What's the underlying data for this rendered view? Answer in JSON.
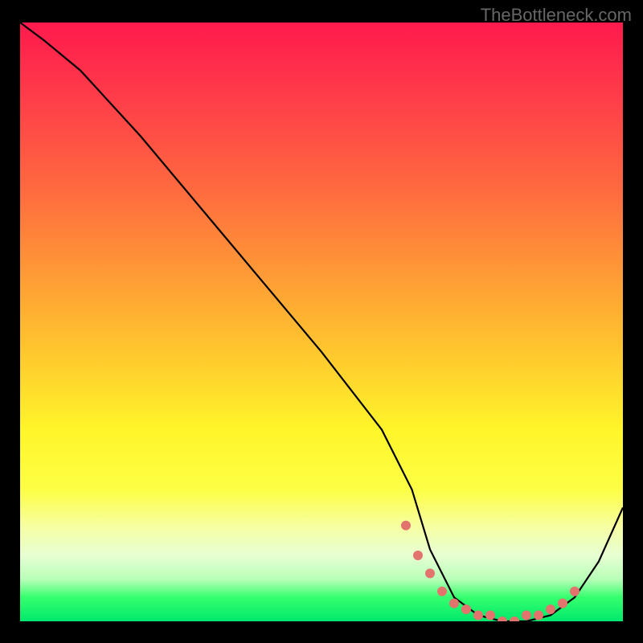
{
  "watermark": "TheBottleneck.com",
  "chart_data": {
    "type": "line",
    "title": "",
    "xlabel": "",
    "ylabel": "",
    "xlim": [
      0,
      100
    ],
    "ylim": [
      0,
      100
    ],
    "series": [
      {
        "name": "bottleneck-curve",
        "x": [
          0,
          4,
          10,
          20,
          30,
          40,
          50,
          60,
          65,
          68,
          72,
          76,
          80,
          84,
          88,
          92,
          96,
          100
        ],
        "values": [
          100,
          97,
          92,
          81,
          69,
          57,
          45,
          32,
          22,
          12,
          4,
          1,
          0,
          0,
          1,
          4,
          10,
          19
        ]
      }
    ],
    "markers": {
      "name": "highlight-dots",
      "x": [
        64,
        66,
        68,
        70,
        72,
        74,
        76,
        78,
        80,
        82,
        84,
        86,
        88,
        90,
        92
      ],
      "values": [
        16,
        11,
        8,
        5,
        3,
        2,
        1,
        1,
        0,
        0,
        1,
        1,
        2,
        3,
        5
      ]
    },
    "colors": {
      "curve": "#000000",
      "marker": "#e2736d",
      "top": "#ff1a4d",
      "bottom": "#00e86b"
    }
  }
}
